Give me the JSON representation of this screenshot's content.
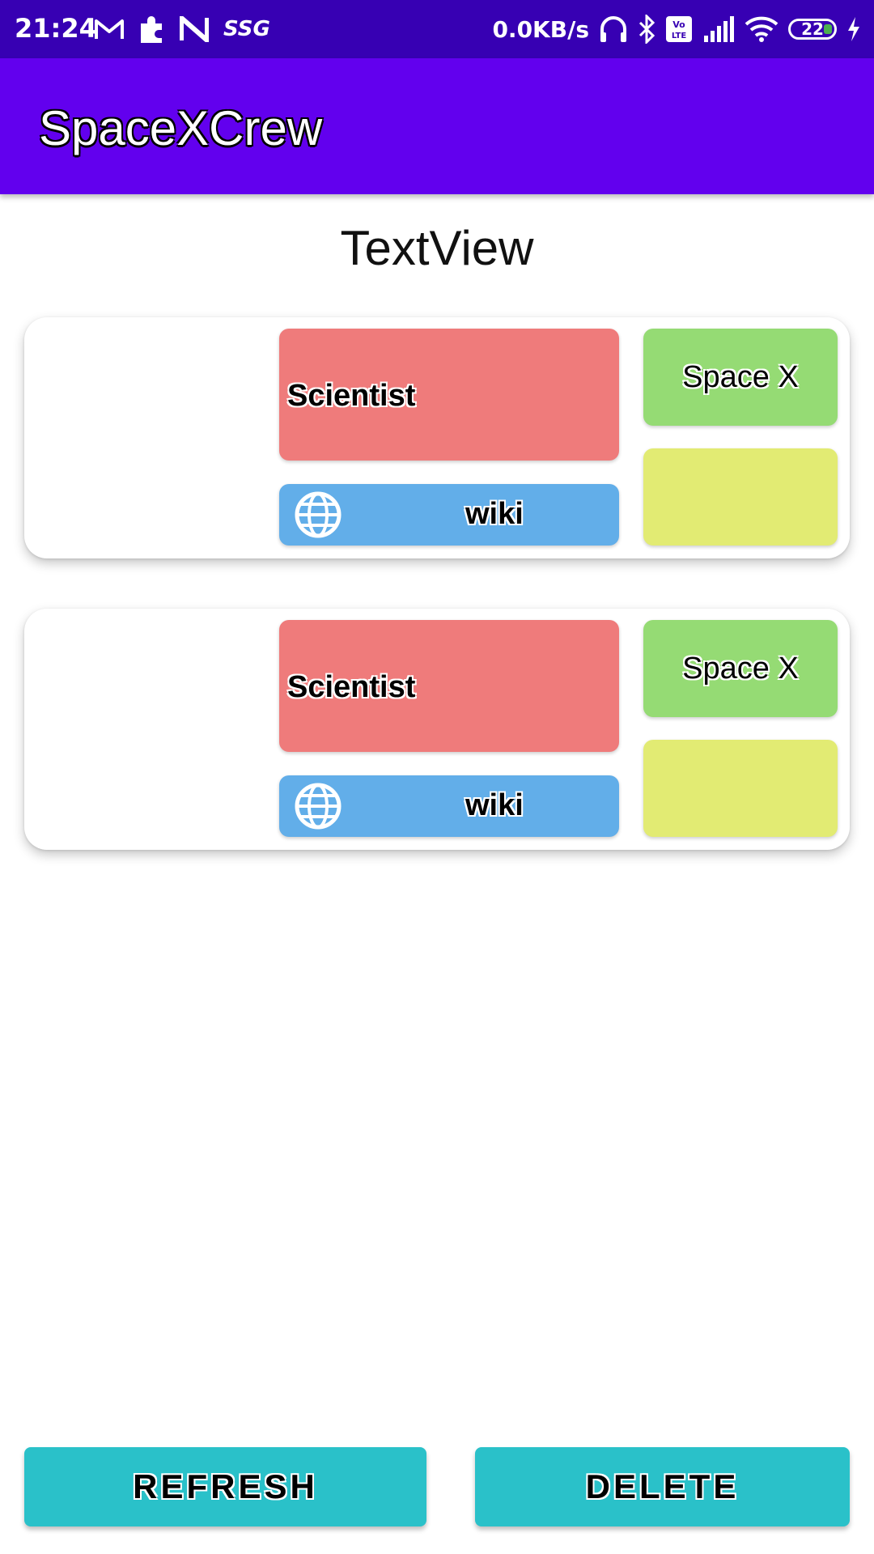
{
  "status_bar": {
    "time": "21:24",
    "carrier_text": "SSG",
    "network_speed": "0.0KB/s",
    "battery_level": "22",
    "icons": [
      "gmail-icon",
      "puzzle-icon",
      "n-app-icon",
      "headphones-icon",
      "bluetooth-icon",
      "volte-icon",
      "signal-icon",
      "wifi-icon",
      "battery-icon",
      "charging-icon"
    ]
  },
  "app_bar": {
    "title": "SpaceXCrew",
    "color": "#6200ee"
  },
  "main": {
    "heading": "TextView",
    "crew_cards": [
      {
        "role": "Scientist",
        "wiki_label": "wiki",
        "agency": "Space X",
        "status": ""
      },
      {
        "role": "Scientist",
        "wiki_label": "wiki",
        "agency": "Space X",
        "status": ""
      }
    ]
  },
  "actions": {
    "refresh_label": "REFRESH",
    "delete_label": "DELETE",
    "color": "#2ac1c9"
  },
  "colors": {
    "status_bar": "#3700b3",
    "role_box": "#ef7b7b",
    "wiki_button": "#62aee9",
    "agency_box": "#95db74",
    "status_box": "#e2eb73"
  }
}
